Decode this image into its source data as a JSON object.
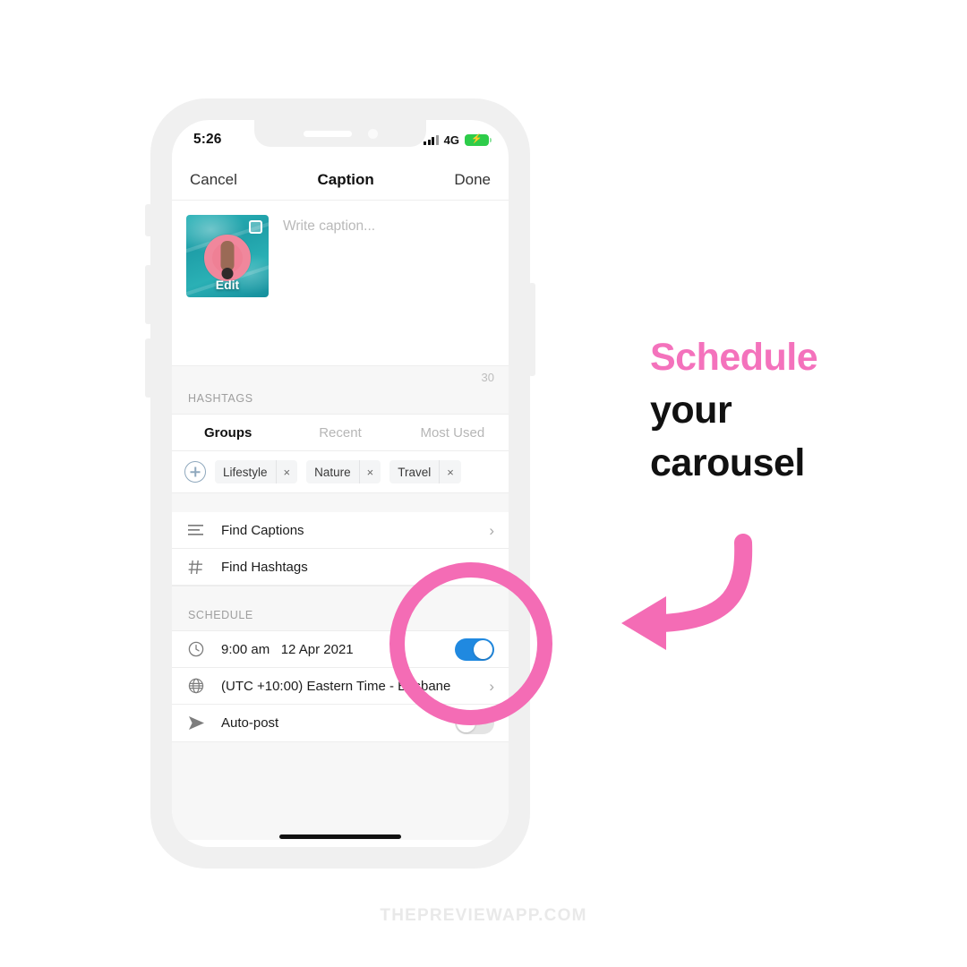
{
  "status_bar": {
    "time": "5:26",
    "network": "4G",
    "signal_icon": "signal-bars-icon",
    "battery_icon": "battery-charging-icon",
    "battery_bolt": "⚡"
  },
  "nav_bar": {
    "cancel_label": "Cancel",
    "title": "Caption",
    "done_label": "Done"
  },
  "caption": {
    "placeholder": "Write caption...",
    "edit_label": "Edit",
    "thumbnail_alt": "pool-float-photo",
    "carousel_badge_icon": "carousel-badge-icon",
    "char_counter": "30"
  },
  "hashtags": {
    "section_label": "HASHTAGS",
    "tabs": [
      {
        "label": "Groups",
        "active": true
      },
      {
        "label": "Recent",
        "active": false
      },
      {
        "label": "Most Used",
        "active": false
      }
    ],
    "add_icon": "plus-circle-icon",
    "chips": [
      {
        "label": "Lifestyle",
        "remove": "×"
      },
      {
        "label": "Nature",
        "remove": "×"
      },
      {
        "label": "Travel",
        "remove": "×"
      }
    ]
  },
  "tools": [
    {
      "label": "Find Captions",
      "icon": "lines-icon",
      "chevron": "›"
    },
    {
      "label": "Find Hashtags",
      "icon": "hash-icon",
      "chevron": "›"
    }
  ],
  "schedule": {
    "section_label": "SCHEDULE",
    "datetime_row": {
      "icon": "clock-icon",
      "time": "9:00 am",
      "date": "12 Apr 2021",
      "toggle_state": "on"
    },
    "timezone_row": {
      "icon": "globe-icon",
      "label": "(UTC +10:00) Eastern Time - Brisbane",
      "chevron": "›"
    },
    "autopost_row": {
      "icon": "send-icon",
      "label": "Auto-post",
      "toggle_state": "off"
    }
  },
  "annotation": {
    "headline_line1": "Schedule",
    "headline_line2": "your",
    "headline_line3": "carousel",
    "highlight_icon": "pink-circle-highlight",
    "arrow_icon": "curved-arrow-left-icon"
  },
  "footer": {
    "watermark": "THEPREVIEWAPP.COM"
  },
  "colors": {
    "pink_accent": "#f472bc",
    "pink_circle": "#f46cb5",
    "toggle_on_blue": "#2089e0",
    "battery_green": "#2ecc4a"
  }
}
